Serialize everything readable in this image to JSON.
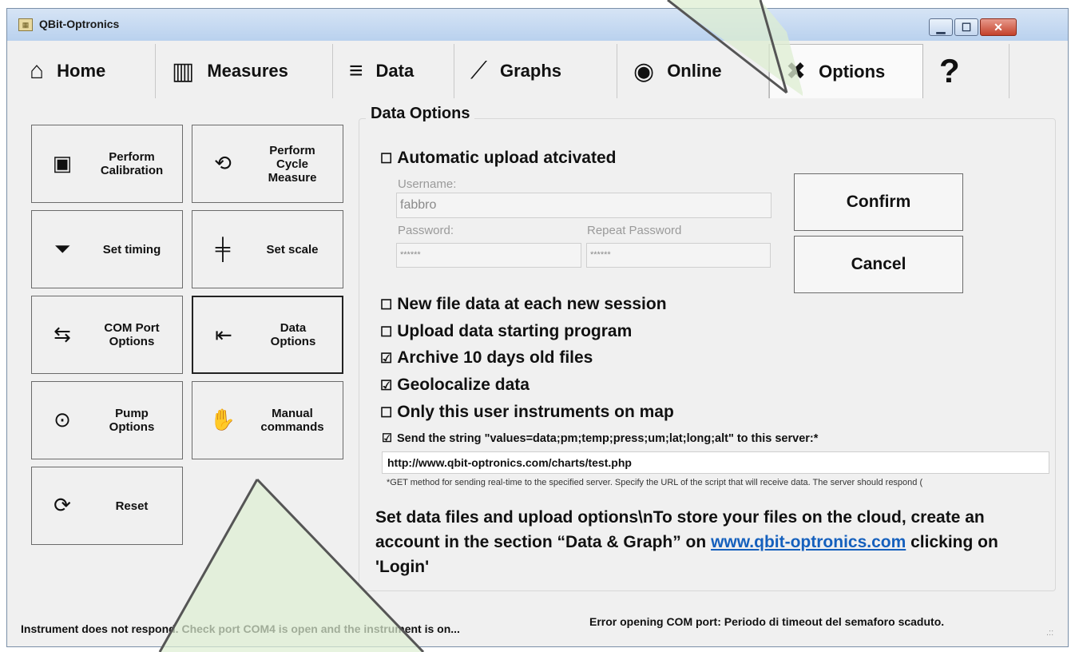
{
  "window": {
    "title": "QBit-Optronics",
    "min": "▁",
    "max": "☐",
    "close": "✕"
  },
  "tabs": [
    {
      "label": "Home",
      "icon": "⌂"
    },
    {
      "label": "Measures",
      "icon": "▥"
    },
    {
      "label": "Data",
      "icon": "≡"
    },
    {
      "label": "Graphs",
      "icon": "⟋"
    },
    {
      "label": "Online",
      "icon": "◉"
    },
    {
      "label": "Options",
      "icon": "✖"
    },
    {
      "label": "",
      "icon": "?"
    }
  ],
  "left_buttons": [
    {
      "label": "Perform\nCalibration",
      "icon": "▣"
    },
    {
      "label": "Perform\nCycle\nMeasure",
      "icon": "⟲"
    },
    {
      "label": "Set timing",
      "icon": "⏷"
    },
    {
      "label": "Set scale",
      "icon": "╪"
    },
    {
      "label": "COM Port\nOptions",
      "icon": "⇆"
    },
    {
      "label": "Data\nOptions",
      "icon": "⇤"
    },
    {
      "label": "Pump\nOptions",
      "icon": "⊙"
    },
    {
      "label": "Manual\ncommands",
      "icon": "✋"
    },
    {
      "label": "Reset",
      "icon": "⟳"
    }
  ],
  "options": {
    "group_title": "Data Options",
    "auto_upload": {
      "label": "Automatic upload atcivated",
      "mark": "☐"
    },
    "username": {
      "label": "Username:",
      "value": "fabbro"
    },
    "password": {
      "label": "Password:",
      "value": "******"
    },
    "repeat_password": {
      "label": "Repeat Password",
      "value": "******"
    },
    "confirm": "Confirm",
    "cancel": "Cancel",
    "checks": [
      {
        "label": "New file data at each new session",
        "mark": "☐"
      },
      {
        "label": "Upload data starting program",
        "mark": "☐"
      },
      {
        "label": "Archive 10 days old files",
        "mark": "☑"
      },
      {
        "label": "Geolocalize data",
        "mark": "☑"
      },
      {
        "label": "Only this user instruments on map",
        "mark": "☐"
      }
    ],
    "server_check": {
      "label": "Send the string \"values=data;pm;temp;press;um;lat;long;alt\" to this server:*",
      "mark": "☑"
    },
    "server_url": "http://www.qbit-optronics.com/charts/test.php",
    "note": "*GET method for sending real-time to the specified server. Specify the URL of the script that will receive data. The server should respond (",
    "info_part1": "Set data files and upload options\\nTo store your files on the cloud, create an account in the section “Data & Graph” on ",
    "info_link": "www.qbit-optronics.com",
    "info_part2": " clicking on 'Login'"
  },
  "status": {
    "left": "Instrument does not respond. Check port COM4 is open and the instrument is on...",
    "right": "Error opening COM port: Periodo di timeout del semaforo scaduto.",
    "grip": ".::"
  }
}
